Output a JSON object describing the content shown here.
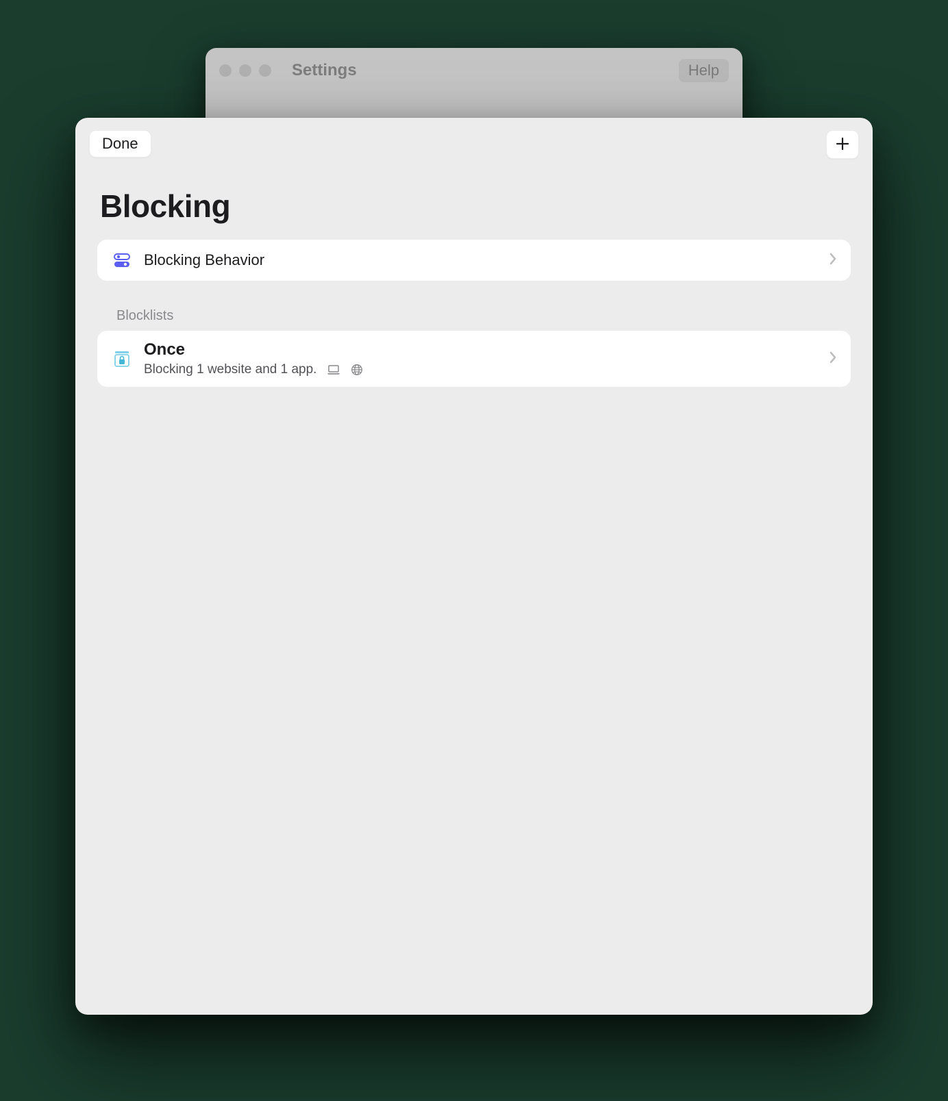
{
  "backdrop": {
    "title": "Settings",
    "help_label": "Help"
  },
  "sheet": {
    "done_label": "Done",
    "page_title": "Blocking",
    "behavior_row_label": "Blocking Behavior",
    "blocklists_section_label": "Blocklists",
    "blocklists": [
      {
        "name": "Once",
        "subtitle": "Blocking 1 website and 1 app."
      }
    ]
  }
}
